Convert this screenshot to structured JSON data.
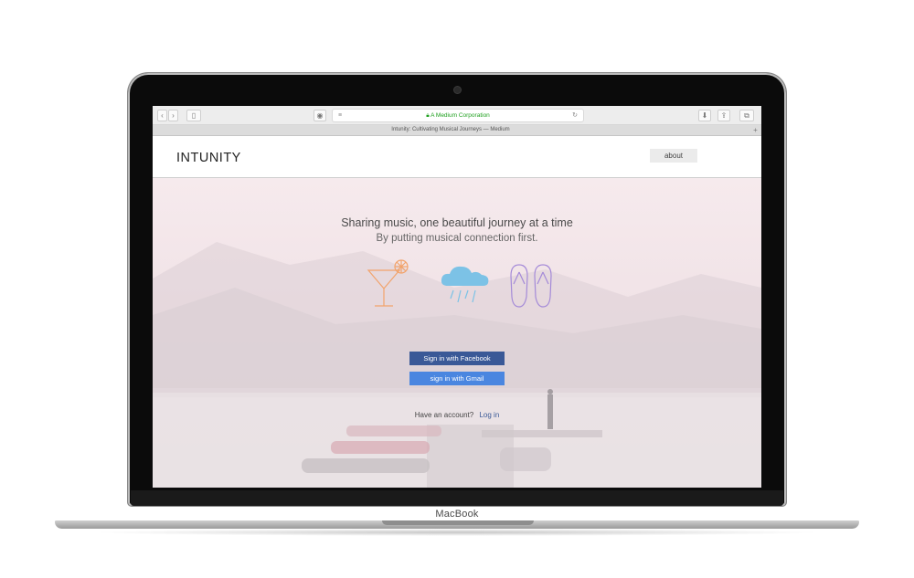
{
  "browser": {
    "address": "A Medium Corporation",
    "tab_title": "Intunity: Cultivating Musical Journeys — Medium"
  },
  "site": {
    "logo": "INTUNITY",
    "nav_about": "about"
  },
  "hero": {
    "tagline": "Sharing music, one beautiful journey at a time",
    "subtagline": "By putting musical connection first.",
    "icons": [
      "cocktail-icon",
      "rain-cloud-icon",
      "flip-flops-icon"
    ],
    "facebook_button": "Sign in with Facebook",
    "gmail_button": "sign in with Gmail",
    "have_account": "Have an account?",
    "login_link": "Log in"
  },
  "device": {
    "brand": "MacBook"
  },
  "colors": {
    "facebook": "#3a5997",
    "gmail": "#4a86e0",
    "cocktail": "#f2a36b",
    "cloud": "#7cc2e6",
    "flipflops": "#a48ad8"
  }
}
